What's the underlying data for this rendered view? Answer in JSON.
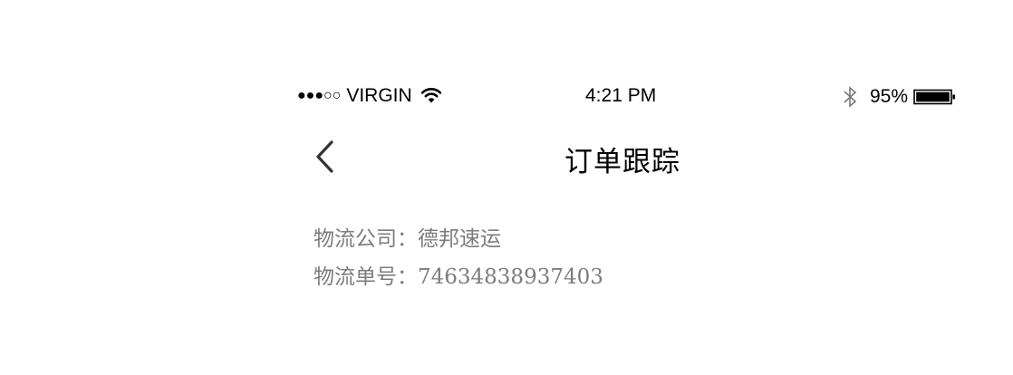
{
  "status_bar": {
    "signal": "●●●○○",
    "carrier": "VIRGIN",
    "time": "4:21 PM",
    "battery_percent": "95%",
    "icons": [
      "wifi-icon",
      "bluetooth-icon",
      "battery-icon"
    ]
  },
  "nav": {
    "back_icon": "chevron-left-icon",
    "title": "订单跟踪"
  },
  "logistics": {
    "company_label": "物流公司：",
    "company_value": "德邦速运",
    "tracking_label": "物流单号：",
    "tracking_value": "74634838937403"
  },
  "colors": {
    "text_primary": "#000000",
    "text_secondary": "#7c7c7c",
    "background": "#ffffff"
  }
}
